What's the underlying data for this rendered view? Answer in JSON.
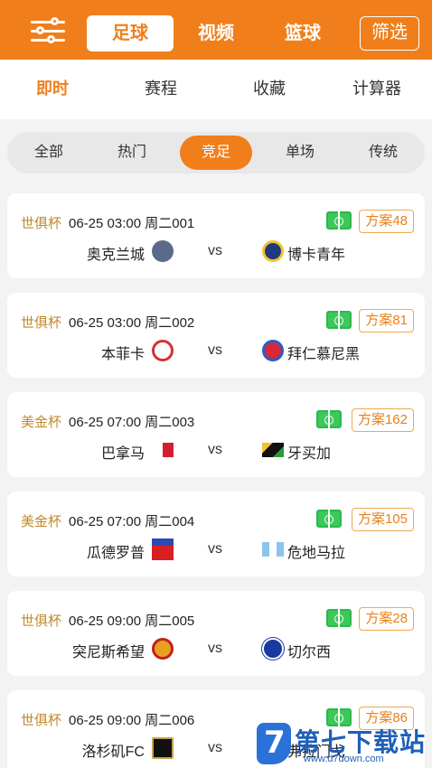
{
  "header": {
    "tabs": [
      {
        "label": "足球",
        "active": true
      },
      {
        "label": "视频",
        "active": false
      },
      {
        "label": "篮球",
        "active": false
      }
    ],
    "filter_label": "筛选",
    "menu_icon": "sliders-icon"
  },
  "subtabs": [
    {
      "label": "即时",
      "active": true
    },
    {
      "label": "赛程",
      "active": false
    },
    {
      "label": "收藏",
      "active": false
    },
    {
      "label": "计算器",
      "active": false
    }
  ],
  "filters": [
    {
      "label": "全部",
      "active": false
    },
    {
      "label": "热门",
      "active": false
    },
    {
      "label": "竞足",
      "active": true
    },
    {
      "label": "单场",
      "active": false
    },
    {
      "label": "传统",
      "active": false
    }
  ],
  "matches": [
    {
      "league": "世俱杯",
      "time": "06-25 03:00 周二001",
      "home": "奥克兰城",
      "away": "博卡青年",
      "vs": "vs",
      "plan": "方案48"
    },
    {
      "league": "世俱杯",
      "time": "06-25 03:00 周二002",
      "home": "本菲卡",
      "away": "拜仁慕尼黑",
      "vs": "vs",
      "plan": "方案81"
    },
    {
      "league": "美金杯",
      "time": "06-25 07:00 周二003",
      "home": "巴拿马",
      "away": "牙买加",
      "vs": "vs",
      "plan": "方案162"
    },
    {
      "league": "美金杯",
      "time": "06-25 07:00 周二004",
      "home": "瓜德罗普",
      "away": "危地马拉",
      "vs": "vs",
      "plan": "方案105"
    },
    {
      "league": "世俱杯",
      "time": "06-25 09:00 周二005",
      "home": "突尼斯希望",
      "away": "切尔西",
      "vs": "vs",
      "plan": "方案28"
    },
    {
      "league": "世俱杯",
      "time": "06-25 09:00 周二006",
      "home": "洛杉矶FC",
      "away": "弗拉门戈",
      "vs": "vs",
      "plan": "方案86"
    }
  ],
  "watermark": {
    "text": "第七下载站",
    "url": "www.d7down.com"
  },
  "colors": {
    "accent": "#f07f1b",
    "league": "#c08a2c",
    "field": "#3cc95a"
  }
}
